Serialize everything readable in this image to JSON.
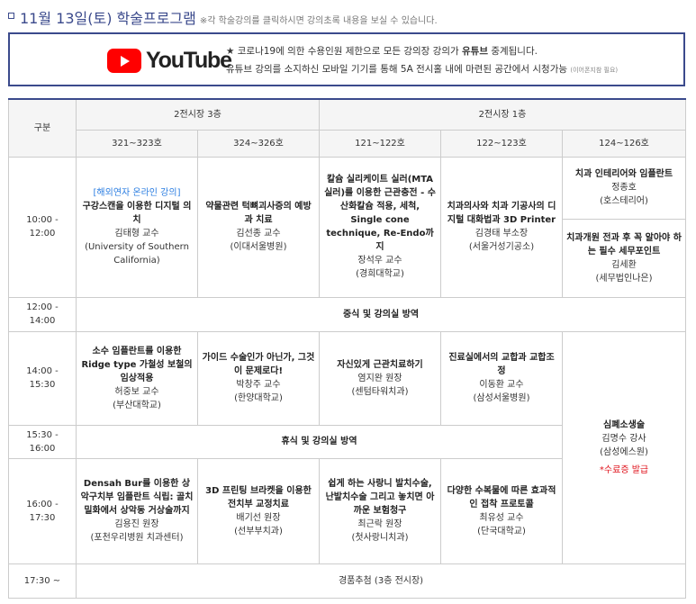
{
  "header": {
    "title": "11월 13일(토) 학술프로그램",
    "note": "※각 학술강의를 클릭하시면 강의초록 내용을 보실 수 있습니다."
  },
  "youtube": {
    "logo_text": "YouTube",
    "line1_pre": "★ 코로나19에 의한 수용인원 제한으로 모든 강의장 강의가 ",
    "line1_bold": "유튜브",
    "line1_post": " 중계됩니다.",
    "line2": "유튜브 강의를 소지하신 모바일 기기를 통해 5A 전시홀 내에 마련된 공간에서 시청가능",
    "line2_small": "(이어폰지참 필요)"
  },
  "table": {
    "col_label": "구분",
    "hall3": "2전시장 3층",
    "hall1": "2전시장 1층",
    "rooms": [
      "321~323호",
      "324~326호",
      "121~122호",
      "122~123호",
      "124~126호"
    ],
    "times": [
      "10:00 - 12:00",
      "12:00 - 14:00",
      "14:00 - 15:30",
      "15:30 - 16:00",
      "16:00 - 17:30",
      "17:30 ~"
    ],
    "s1": {
      "a": {
        "tag": "[해외연자 온라인 강의]",
        "title": "구강스캔을 이용한 디지털 의치",
        "speaker": "김태형 교수",
        "org": "(University of Southern California)"
      },
      "b": {
        "title": "약물관련 턱뼈괴사증의 예방과 치료",
        "speaker": "김선종 교수",
        "org": "(이대서울병원)"
      },
      "c": {
        "title": "칼슘 실리케이트 실러(MTA 실러)를 이용한 근관충전 - 수산화칼슘 적용, 세척, Single cone technique, Re-Endo까지",
        "speaker": "장석우 교수",
        "org": "(경희대학교)"
      },
      "d": {
        "title": "치과의사와 치과 기공사의 디지털 대화법과 3D Printer",
        "speaker": "김경태 부소장",
        "org": "(서울거성기공소)"
      },
      "e1": {
        "title": "치과 인테리어와 임플란트",
        "speaker": "정종호",
        "org": "(호스테리어)"
      },
      "e2": {
        "title": "치과개원 전과 후 꼭 알아야 하는 필수 세무포인트",
        "speaker": "김세환",
        "org": "(세무법인나은)"
      }
    },
    "lunch": "중식 및 강의실 방역",
    "s2": {
      "a": {
        "title": "소수 임플란트를 이용한 Ridge type 가철성 보철의 임상적용",
        "speaker": "허중보 교수",
        "org": "(부산대학교)"
      },
      "b": {
        "title": "가이드 수술인가 아닌가, 그것이 문제로다!",
        "speaker": "박창주 교수",
        "org": "(한양대학교)"
      },
      "c": {
        "title": "자신있게 근관치료하기",
        "speaker": "염지완 원장",
        "org": "(센텀타워치과)"
      },
      "d": {
        "title": "진료실에서의 교합과 교합조정",
        "speaker": "이동환 교수",
        "org": "(삼성서울병원)"
      }
    },
    "cpr": {
      "title": "심폐소생술",
      "speaker": "김명수 강사",
      "org": "(삼성에스원)",
      "note": "*수료증 발급"
    },
    "break": "휴식 및 강의실 방역",
    "s3": {
      "a": {
        "title": "Densah Bur를 이용한 상악구치부 임플란트 식립: 골치밀화에서 상악동 거상술까지",
        "speaker": "김용진 원장",
        "org": "(포천우리병원 치과센터)"
      },
      "b": {
        "title": "3D 프린팅 브라켓을 이용한 전치부 교정치료",
        "speaker": "배기선 원장",
        "org": "(선부부치과)"
      },
      "c": {
        "title": "쉽게 하는 사랑니 발치수술, 난발치수술 그리고 놓치면 아까운 보험청구",
        "speaker": "최근락 원장",
        "org": "(첫사랑니치과)"
      },
      "d": {
        "title": "다양한 수복물에 따른 효과적인 접착 프로토콜",
        "speaker": "최유성 교수",
        "org": "(단국대학교)"
      }
    },
    "closing": "경품추첨 (3층 전시장)"
  }
}
